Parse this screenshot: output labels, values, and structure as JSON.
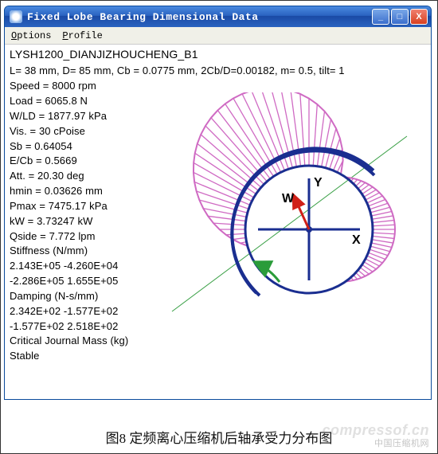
{
  "window": {
    "title": "Fixed Lobe Bearing Dimensional Data",
    "buttons": {
      "min": "_",
      "max": "□",
      "close": "X"
    }
  },
  "menu": {
    "options": {
      "label": "Options",
      "accel": "O"
    },
    "profile": {
      "label": "Profile",
      "accel": "P"
    }
  },
  "body": {
    "name": "LYSH1200_DIANJIZHOUCHENG_B1",
    "geom": "L= 38 mm, D= 85 mm, Cb = 0.0775 mm, 2Cb/D=0.00182, m= 0.5, tilt= 1",
    "speed": "Speed = 8000 rpm",
    "load": "Load = 6065.8 N",
    "wld": "W/LD = 1877.97 kPa",
    "vis": "Vis. = 30 cPoise",
    "sb": "Sb = 0.64054",
    "ecb": "E/Cb = 0.5669",
    "att": "Att. = 20.30 deg",
    "hmin": "hmin = 0.03626 mm",
    "pmax": "Pmax = 7475.17 kPa",
    "kw": "kW = 3.73247 kW",
    "qside": "Qside = 7.772 lpm",
    "stiff_h": "Stiffness (N/mm)",
    "stiff_r1": " 2.143E+05  -4.260E+04",
    "stiff_r2": "-2.286E+05   1.655E+05",
    "damp_h": "Damping (N-s/mm)",
    "damp_r1": " 2.342E+02  -1.577E+02",
    "damp_r2": "-1.577E+02   2.518E+02",
    "cjm": "Critical Journal Mass (kg)",
    "stable": "Stable"
  },
  "axes": {
    "y": "Y",
    "x": "X",
    "w": "W"
  },
  "caption": "图8  定频离心压缩机后轴承受力分布图",
  "watermark": {
    "line1": "compressof.cn",
    "line2": "中国压缩机网"
  },
  "chart_data": {
    "type": "polar-pressure-distribution",
    "title": "Fixed Lobe Bearing Pressure Distribution",
    "journal_radius_px": 80,
    "lobes": 2,
    "pressure_max_kpa": 7475.17,
    "attitude_angle_deg": 20.3,
    "load_direction_deg_from_vertical": -20,
    "lobe_pressure_profiles": [
      {
        "name": "upper-left-lobe",
        "angle_range_deg": [
          60,
          200
        ],
        "peak_relative": 1.0,
        "color": "#d070c8"
      },
      {
        "name": "right-lobe",
        "angle_range_deg": [
          -60,
          60
        ],
        "peak_relative": 0.35,
        "color": "#d070c8"
      }
    ],
    "bearing_arcs": [
      {
        "angle_range_deg": [
          30,
          180
        ],
        "color": "#203a9c"
      },
      {
        "angle_range_deg": [
          210,
          360
        ],
        "color": "#203a9c"
      }
    ],
    "diagonal_line": {
      "angle_deg": 135,
      "color": "#2a9c3a"
    }
  }
}
